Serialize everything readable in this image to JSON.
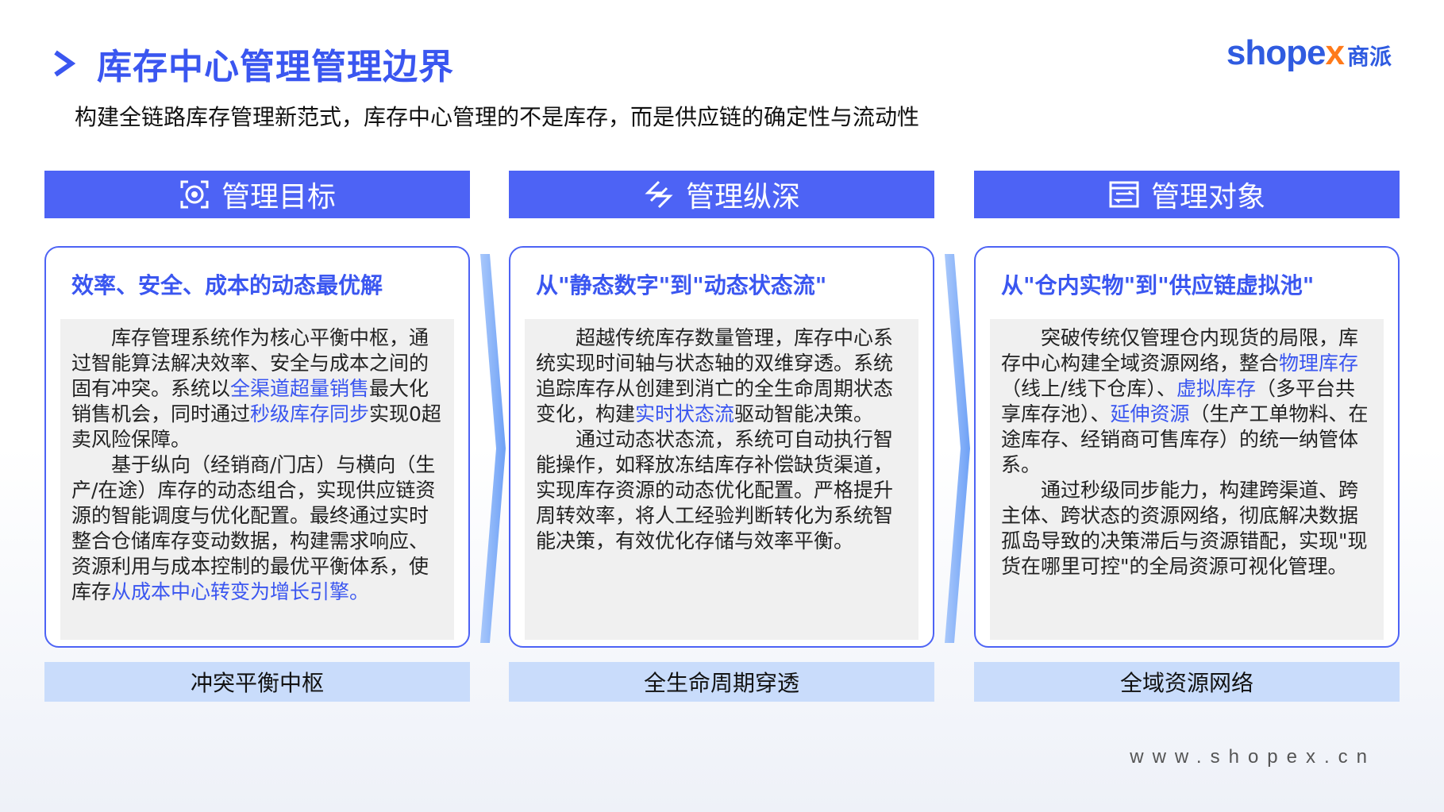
{
  "header": {
    "title": "库存中心管理管理边界",
    "subtitle": "构建全链路库存管理新范式，库存中心管理的不是库存，而是供应链的确定性与流动性",
    "logo_en_a": "shope",
    "logo_en_b": "x",
    "logo_cn": "商派",
    "accent_color": "#3a56f0"
  },
  "columns": [
    {
      "head": "管理目标",
      "icon": "target-icon",
      "card_title": "效率、安全、成本的动态最优解",
      "p1": [
        {
          "t": "库存管理系统作为核心平衡中枢，通过智能算法解决效率、安全与成本之间的固有冲突。系统以"
        },
        {
          "h": "全渠道超量销售"
        },
        {
          "t": "最大化销售机会，同时通过"
        },
        {
          "h": "秒级库存同步"
        },
        {
          "t": "实现0超卖风险保障。"
        }
      ],
      "p2": [
        {
          "t": "基于纵向（经销商/门店）与横向（生产/在途）库存的动态组合，实现供应链资源的智能调度与优化配置。最终通过实时整合仓储库存变动数据，构建需求响应、资源利用与成本控制的最优平衡体系，使库存"
        },
        {
          "h": "从成本中心转变为增长引擎。"
        }
      ],
      "foot": "冲突平衡中枢"
    },
    {
      "head": "管理纵深",
      "icon": "layers-icon",
      "card_title": "从\"静态数字\"到\"动态状态流\"",
      "p1": [
        {
          "t": "超越传统库存数量管理，库存中心系统实现时间轴与状态轴的双维穿透。系统追踪库存从创建到消亡的全生命周期状态变化，构建"
        },
        {
          "h": "实时状态流"
        },
        {
          "t": "驱动智能决策。"
        }
      ],
      "p2": [
        {
          "t": "通过动态状态流，系统可自动执行智能操作，如释放冻结库存补偿缺货渠道，实现库存资源的动态优化配置。严格提升周转效率，将人工经验判断转化为系统智能决策，有效优化存储与效率平衡。"
        }
      ],
      "foot": "全生命周期穿透"
    },
    {
      "head": "管理对象",
      "icon": "transfer-icon",
      "card_title": "从\"仓内实物\"到\"供应链虚拟池\"",
      "p1": [
        {
          "t": "突破传统仅管理仓内现货的局限，库存中心构建全域资源网络，整合"
        },
        {
          "h": "物理库存"
        },
        {
          "t": "（线上/线下仓库）、"
        },
        {
          "h": "虚拟库存"
        },
        {
          "t": "（多平台共享库存池）、"
        },
        {
          "h": "延伸资源"
        },
        {
          "t": "（生产工单物料、在途库存、经销商可售库存）的统一纳管体系。"
        }
      ],
      "p2": [
        {
          "t": "通过秒级同步能力，构建跨渠道、跨主体、跨状态的资源网络，彻底解决数据孤岛导致的决策滞后与资源错配，实现\"现货在哪里可控\"的全局资源可视化管理。"
        }
      ],
      "foot": "全域资源网络"
    }
  ],
  "footer": {
    "url": "www.shopex.cn"
  }
}
